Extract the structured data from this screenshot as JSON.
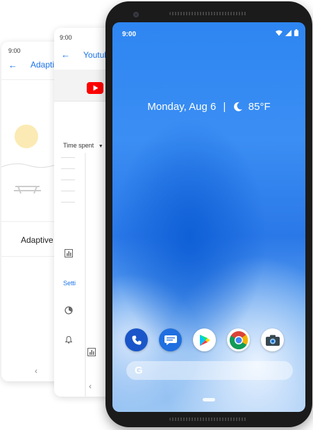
{
  "back_card": {
    "status_time": "9:00",
    "title": "Adaptive",
    "label": "Adaptive",
    "nav_back": "‹"
  },
  "mid_card": {
    "status_time": "9:00",
    "title": "Youtube",
    "dropdown_label": "Time spent",
    "settings_link": "Setti",
    "nav_back": "‹"
  },
  "phone": {
    "status_time": "9:00",
    "date": "Monday, Aug 6",
    "separator": "|",
    "temperature": "85°F",
    "search_letter": "G",
    "dock": [
      "phone-app",
      "messages-app",
      "play-store-app",
      "chrome-app",
      "camera-app"
    ]
  },
  "colors": {
    "accent": "#1a73e8",
    "wallpaper": "#2e86f2",
    "youtube_red": "#ff0000"
  }
}
